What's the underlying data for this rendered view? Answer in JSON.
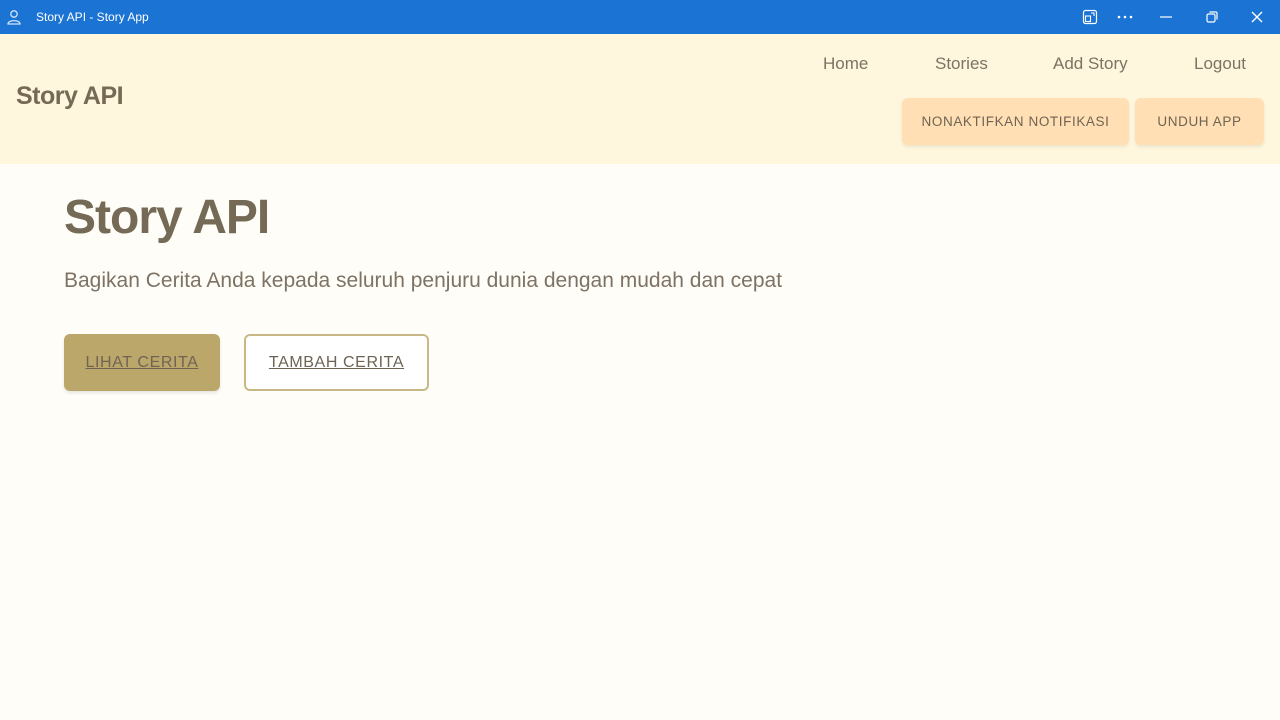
{
  "window": {
    "title": "Story API - Story App",
    "icons": {
      "app": "person-icon",
      "cast": "cast-icon",
      "more": "more-icon",
      "minimize": "minimize-icon",
      "restore": "restore-icon",
      "close": "close-icon"
    }
  },
  "header": {
    "brand": "Story API",
    "nav": {
      "home": "Home",
      "stories": "Stories",
      "add_story": "Add Story",
      "logout": "Logout"
    },
    "buttons": {
      "notifications": "NONAKTIFKAN NOTIFIKASI",
      "download_app": "UNDUH APP"
    }
  },
  "hero": {
    "title": "Story API",
    "subtitle": "Bagikan Cerita Anda kepada seluruh penjuru dunia dengan mudah dan cepat",
    "primary_cta": "LIHAT CERITA",
    "secondary_cta": "TAMBAH CERITA"
  },
  "colors": {
    "titlebar": "#1b74d3",
    "header_bg": "#fff7dd",
    "page_bg": "#fffdf8",
    "text_dark": "#756a55",
    "header_button": "#ffdfb3",
    "primary_button": "#bca76a",
    "secondary_border": "#c8b888"
  }
}
